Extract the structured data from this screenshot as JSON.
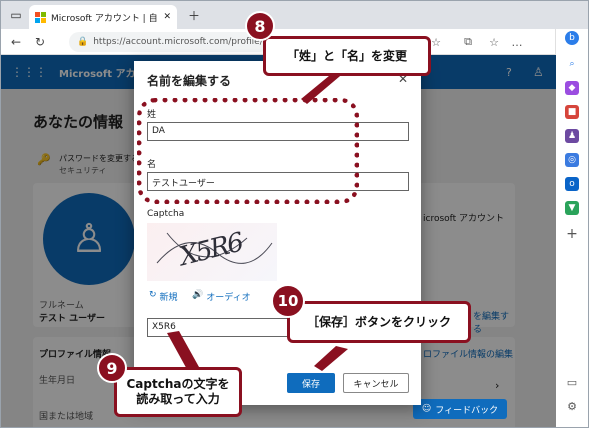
{
  "browser": {
    "tab_title": "Microsoft アカウント | 自分のプロフィール",
    "url": "https://account.microsoft.com/profile/edit"
  },
  "header": {
    "brand": "Microsoft アカウント",
    "help": "?",
    "account_icon": "person-icon"
  },
  "page": {
    "title": "あなたの情報",
    "password_link": "パスワードを変更する",
    "security_label": "セキュリティ",
    "full_name_label": "フルネーム",
    "full_name_value": "テスト ユーザー",
    "profile_info_heading": "プロファイル情報",
    "birthdate_label": "生年月日",
    "country_label": "国または地域",
    "right_account_label": "icrosoft アカウント",
    "right_edit_name": "を編集する",
    "right_edit_profile": "ロファイル情報の編集",
    "feedback_button": "フィードバック"
  },
  "dialog": {
    "title": "名前を編集する",
    "close_icon": "close-icon",
    "surname_label": "姓",
    "surname_value": "DA",
    "given_label": "名",
    "given_value": "テストユーザー",
    "captcha_label": "Captcha",
    "captcha_image_text": "X5R6",
    "new_link": "新規",
    "audio_link": "オーディオ",
    "captcha_value": "X5R6",
    "save_button": "保存",
    "cancel_button": "キャンセル"
  },
  "annotations": {
    "step8_number": "8",
    "step8_text": "「姓」と「名」を変更",
    "step9_number": "9",
    "step9_text_line1": "Captchaの文字を",
    "step9_text_line2": "読み取って入力",
    "step10_number": "10",
    "step10_text": "［保存］ボタンをクリック",
    "accent_color": "#8a1020"
  }
}
